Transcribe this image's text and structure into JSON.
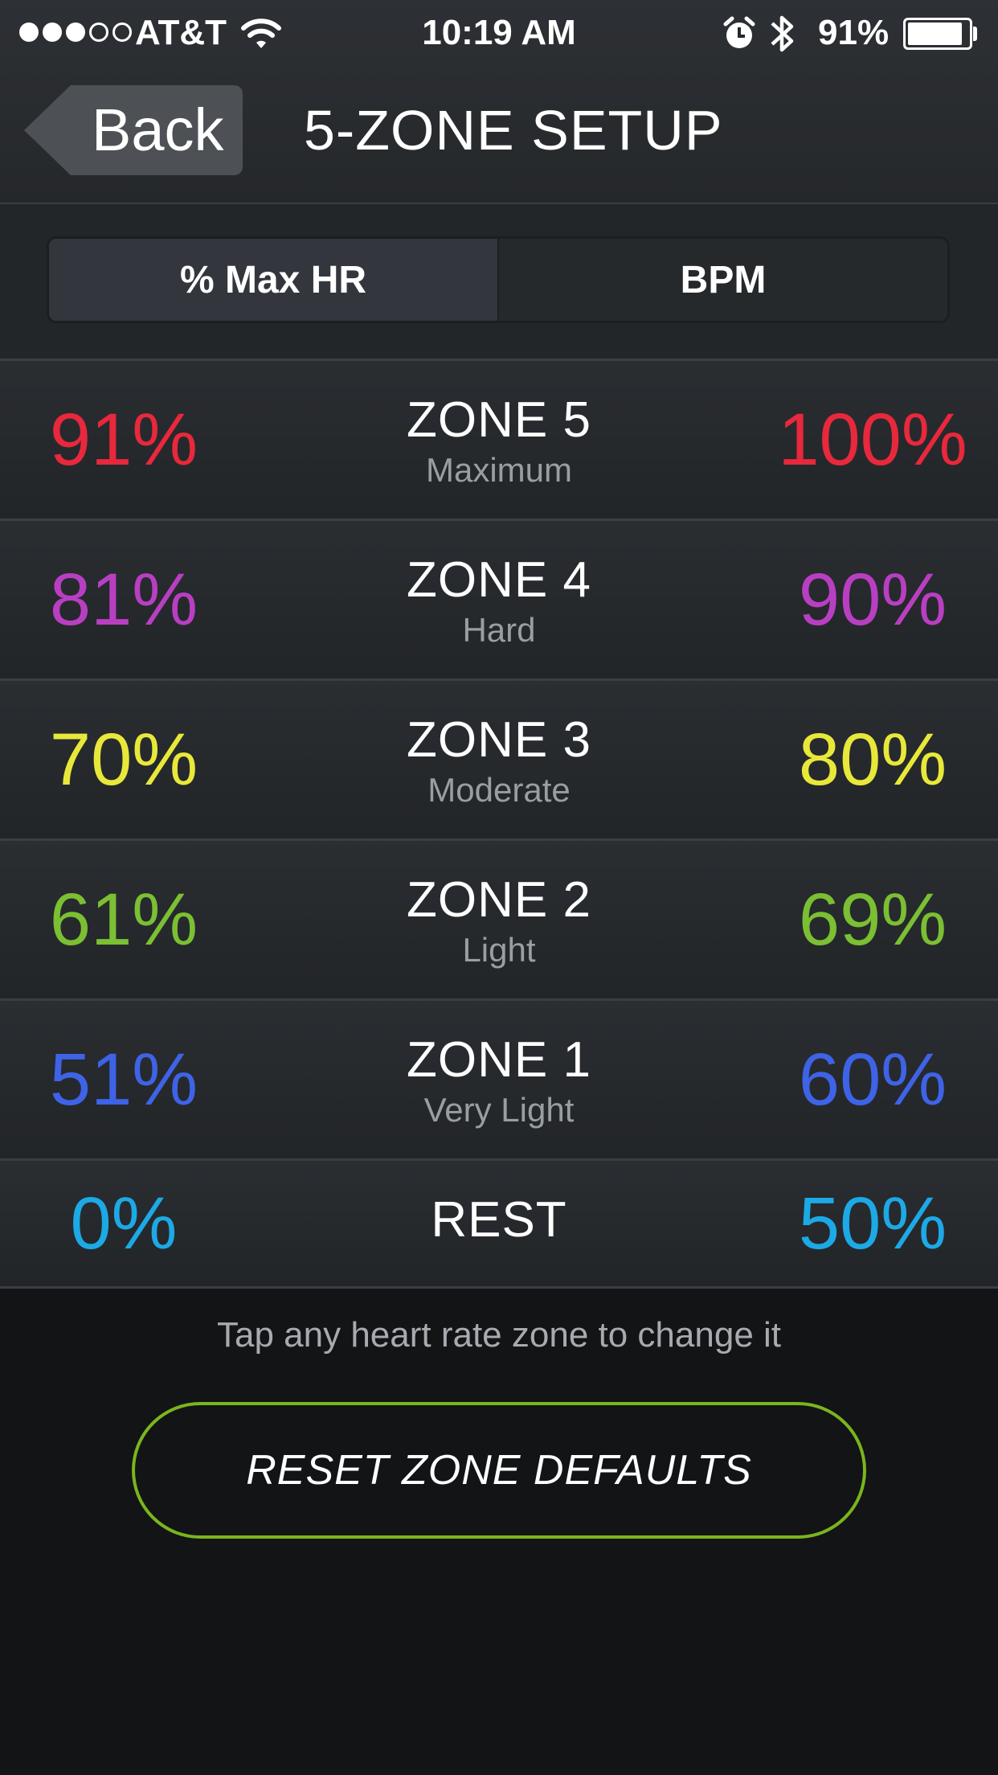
{
  "status_bar": {
    "signal_dots_filled": 3,
    "signal_dots_total": 5,
    "carrier": "AT&T",
    "time": "10:19 AM",
    "battery_pct": "91%",
    "battery_level": 0.91,
    "icons": [
      "wifi-icon",
      "alarm-clock-icon",
      "bluetooth-icon",
      "battery-icon"
    ]
  },
  "nav": {
    "back_label": "Back",
    "title": "5-ZONE SETUP"
  },
  "segmented": {
    "options": [
      {
        "label": "% Max HR",
        "selected": true
      },
      {
        "label": "BPM",
        "selected": false
      }
    ]
  },
  "zones": [
    {
      "low": "91%",
      "name": "ZONE 5",
      "desc": "Maximum",
      "high": "100%",
      "color": "#e8283c"
    },
    {
      "low": "81%",
      "name": "ZONE 4",
      "desc": "Hard",
      "high": "90%",
      "color": "#b83fc2"
    },
    {
      "low": "70%",
      "name": "ZONE 3",
      "desc": "Moderate",
      "high": "80%",
      "color": "#e8e83a"
    },
    {
      "low": "61%",
      "name": "ZONE 2",
      "desc": "Light",
      "high": "69%",
      "color": "#7bbf32"
    },
    {
      "low": "51%",
      "name": "ZONE 1",
      "desc": "Very Light",
      "high": "60%",
      "color": "#3e63e6"
    },
    {
      "low": "0%",
      "name": "REST",
      "desc": "",
      "high": "50%",
      "color": "#1ca9e6"
    }
  ],
  "hint": "Tap any heart rate zone to change it",
  "reset_button": "RESET ZONE DEFAULTS",
  "colors": {
    "accent_green": "#7ab51d",
    "background": "#121416"
  }
}
